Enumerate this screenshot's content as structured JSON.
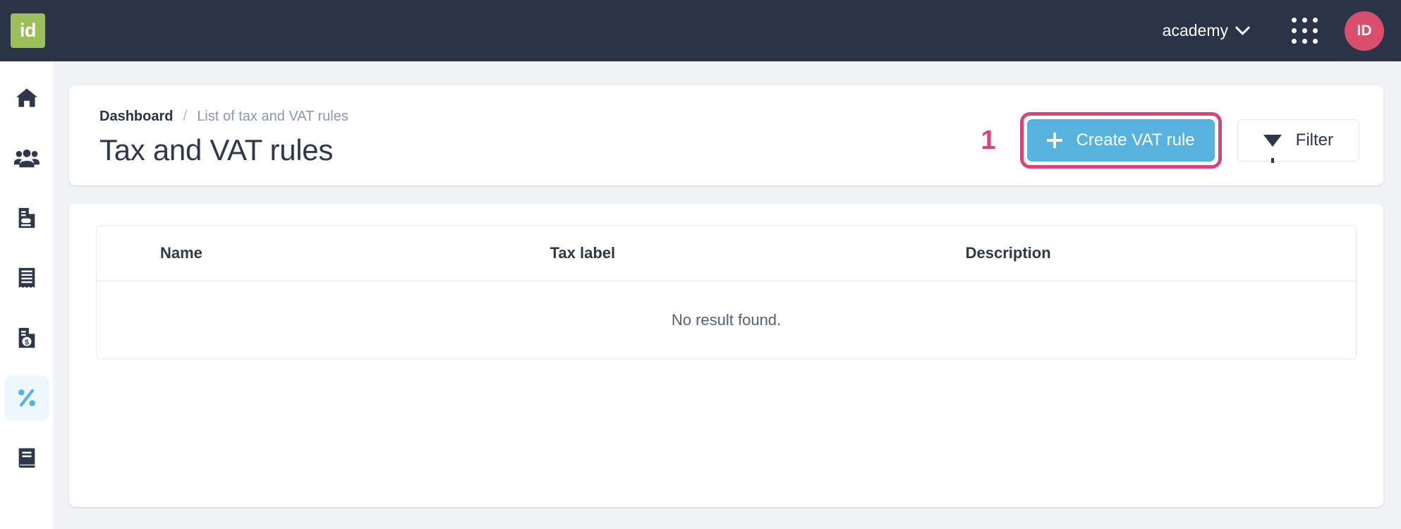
{
  "topbar": {
    "logo_text": "id",
    "tenant": "academy",
    "apps_icon": "grid-icon",
    "avatar_initials": "ID",
    "brand_green": "#9dbf5a",
    "bar_color": "#2b3446",
    "avatar_color": "#da4e6d"
  },
  "sidebar": {
    "items": [
      {
        "name": "home",
        "icon": "home-icon",
        "active": false
      },
      {
        "name": "customers",
        "icon": "users-icon",
        "active": false
      },
      {
        "name": "quotes",
        "icon": "document-icon",
        "active": false
      },
      {
        "name": "receipts",
        "icon": "receipt-icon",
        "active": false
      },
      {
        "name": "invoices",
        "icon": "invoice-dollar-icon",
        "active": false
      },
      {
        "name": "tax-vat-rules",
        "icon": "percent-icon",
        "active": true
      },
      {
        "name": "catalog",
        "icon": "book-icon",
        "active": false
      }
    ],
    "active_bg": "#eef8fc",
    "active_color": "#57b3dd"
  },
  "header": {
    "breadcrumb": {
      "root": "Dashboard",
      "separator": "/",
      "current": "List of tax and VAT rules"
    },
    "title": "Tax and VAT rules"
  },
  "actions": {
    "step_number": "1",
    "create_label": "Create VAT rule",
    "create_icon": "plus-icon",
    "filter_label": "Filter",
    "filter_icon": "funnel-icon",
    "accent_blue": "#57b3dd",
    "highlight_pink": "#d4457e"
  },
  "table": {
    "columns": [
      "Name",
      "Tax label",
      "Description"
    ],
    "rows": [],
    "empty_message": "No result found."
  }
}
